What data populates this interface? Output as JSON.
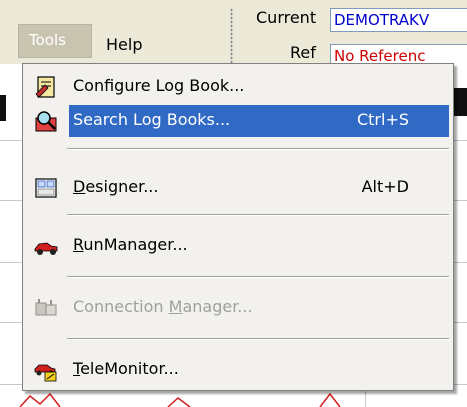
{
  "menubar": {
    "tools_label": "Tools",
    "help_label": "Help"
  },
  "fields": {
    "current_label": "Current",
    "current_value": "DEMOTRAKV",
    "ref_label": "Ref",
    "ref_value": "No Referenc"
  },
  "menu": {
    "items": [
      {
        "label": "Configure Log Book...",
        "icon": "logbook-config-icon",
        "shortcut": ""
      },
      {
        "label": "Search Log Books...",
        "icon": "search-logbook-icon",
        "shortcut": "Ctrl+S",
        "highlighted": true
      },
      {
        "label_pre": "",
        "label_u": "D",
        "label_post": "esigner...",
        "icon": "designer-icon",
        "shortcut": "Alt+D"
      },
      {
        "label_pre": "",
        "label_u": "R",
        "label_post": "unManager...",
        "icon": "runmanager-car-icon",
        "shortcut": ""
      },
      {
        "label_pre": "Connection ",
        "label_u": "M",
        "label_post": "anager...",
        "icon": "connection-manager-icon",
        "shortcut": "",
        "disabled": true
      },
      {
        "label_pre": "",
        "label_u": "T",
        "label_post": "eleMonitor...",
        "icon": "telemonitor-icon",
        "shortcut": ""
      }
    ]
  },
  "colors": {
    "highlight": "#316ac5",
    "current_value_color": "#0000cc",
    "ref_value_color": "#cc0000",
    "disabled_text": "#a0a09a"
  }
}
